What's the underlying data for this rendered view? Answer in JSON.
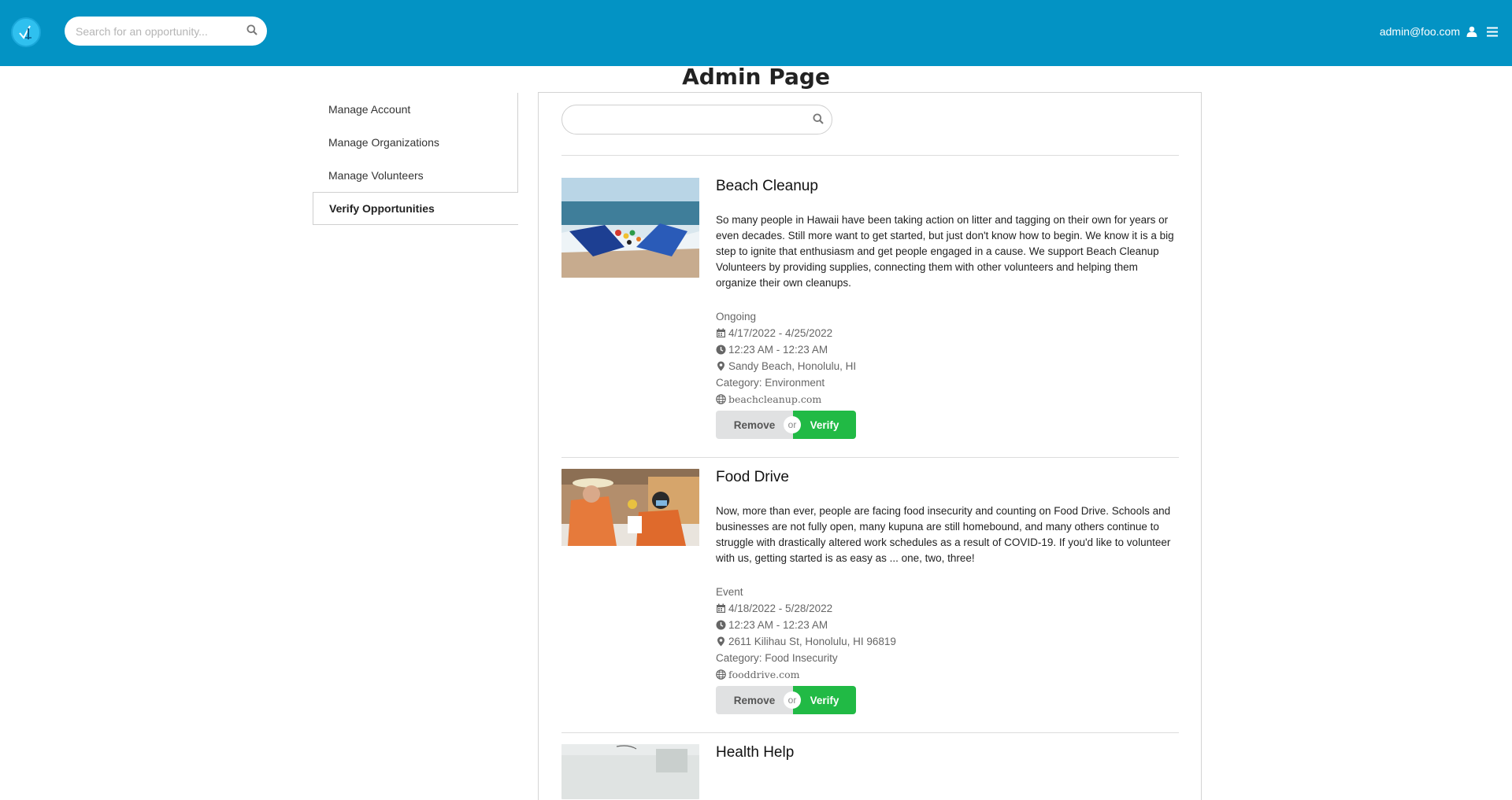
{
  "header": {
    "search_placeholder": "Search for an opportunity...",
    "user_email": "admin@foo.com",
    "brand_color": "#0393c4"
  },
  "page": {
    "title": "Admin Page"
  },
  "sidebar": {
    "items": [
      {
        "label": "Manage Account",
        "active": false
      },
      {
        "label": "Manage Organizations",
        "active": false
      },
      {
        "label": "Manage Volunteers",
        "active": false
      },
      {
        "label": "Verify Opportunities",
        "active": true
      }
    ]
  },
  "panel": {
    "search_placeholder": ""
  },
  "opportunities": [
    {
      "title": "Beach Cleanup",
      "description": "So many people in Hawaii have been taking action on litter and tagging on their own for years or even decades. Still more want to get started, but just don't know how to begin. We know it is a big step to ignite that enthusiasm and get people engaged in a cause. We support Beach Cleanup Volunteers by providing supplies, connecting them with other volunteers and helping them organize their own cleanups.",
      "type": "Ongoing",
      "dates": "4/17/2022 - 4/25/2022",
      "time": "12:23 AM - 12:23 AM",
      "location": "Sandy Beach, Honolulu, HI",
      "category_label": "Category:",
      "category": "Environment",
      "website": "beachcleanup.com",
      "remove_label": "Remove",
      "or_label": "or",
      "verify_label": "Verify"
    },
    {
      "title": "Food Drive",
      "description": "Now, more than ever, people are facing food insecurity and counting on Food Drive. Schools and businesses are not fully open, many kupuna are still homebound, and many others continue to struggle with drastically altered work schedules as a result of COVID-19. If you'd like to volunteer with us, getting started is as easy as ... one, two, three!",
      "type": "Event",
      "dates": "4/18/2022 - 5/28/2022",
      "time": "12:23 AM - 12:23 AM",
      "location": "2611 Kilihau St, Honolulu, HI 96819",
      "category_label": "Category:",
      "category": "Food Insecurity",
      "website": "fooddrive.com",
      "remove_label": "Remove",
      "or_label": "or",
      "verify_label": "Verify"
    },
    {
      "title": "Health Help"
    }
  ],
  "colors": {
    "verify_green": "#21ba45",
    "remove_grey": "#e0e1e2"
  },
  "icons": [
    "logo-icon",
    "search-icon",
    "user-icon",
    "hamburger-icon",
    "calendar-icon",
    "clock-icon",
    "map-pin-icon",
    "globe-icon"
  ]
}
